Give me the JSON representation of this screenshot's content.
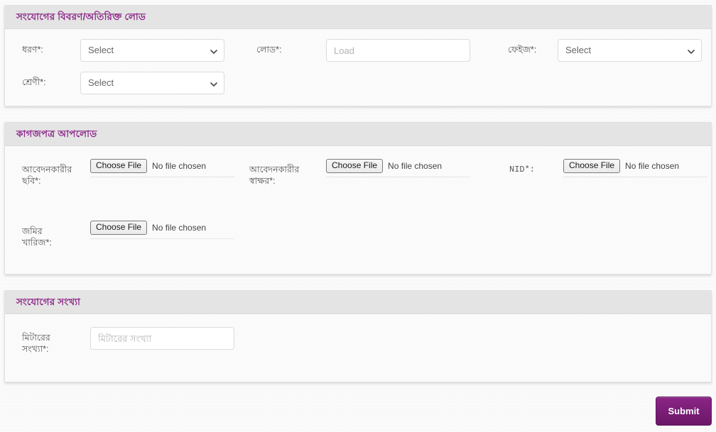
{
  "panels": {
    "connection": {
      "title": "সংযোগের বিবরণ/অতিরিক্ত লোড",
      "fields": {
        "type_label": "ধরণ*:",
        "type_value": "Select",
        "load_label": "লোড*:",
        "load_placeholder": "Load",
        "load_value": "",
        "phase_label": "ফেইজ*:",
        "phase_value": "Select",
        "class_label": "শ্রেণী*:",
        "class_value": "Select"
      }
    },
    "documents": {
      "title": "কাগজপত্র আপলোড",
      "rows": [
        {
          "label": "আবেদনকারীর\nছবি*:",
          "button": "Choose File",
          "status": "No file chosen"
        },
        {
          "label": "আবেদনকারীর\nস্বাক্ষর*:",
          "button": "Choose File",
          "status": "No file chosen"
        },
        {
          "label": "NID*:",
          "button": "Choose File",
          "status": "No file chosen"
        },
        {
          "label": "জমির\nখারিজ*:",
          "button": "Choose File",
          "status": "No file chosen"
        }
      ]
    },
    "meters": {
      "title": "সংযোগের সংখ্যা",
      "meter_label": "মিটারের\nসংখ্যা*:",
      "meter_placeholder": "মিটারের সংখ্যা",
      "meter_value": ""
    }
  },
  "actions": {
    "submit_label": "Submit"
  },
  "colors": {
    "title_purple": "#8e2a8b",
    "submit_purple": "#7c1f78",
    "panel_header": "#e4e4e4",
    "panel_body": "#f7f7f7"
  },
  "icons": {
    "chevron": "chevron-down-icon"
  }
}
